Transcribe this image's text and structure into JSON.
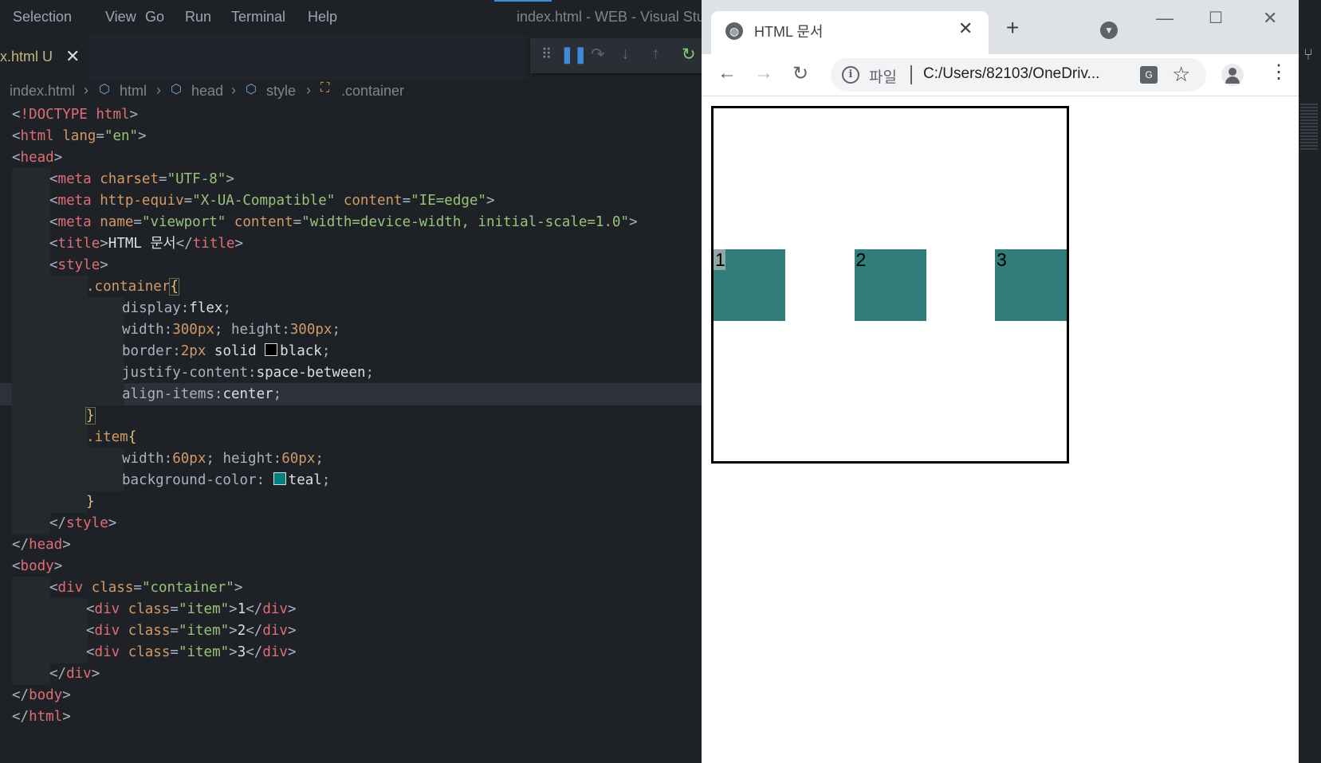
{
  "vscode": {
    "menu": [
      "Selection",
      "View",
      "Go",
      "Run",
      "Terminal",
      "Help"
    ],
    "window_title": "index.html - WEB - Visual Stu",
    "tab": {
      "name": "x.html U",
      "close": "✕"
    },
    "debug_icons": [
      "drag-handle-icon",
      "pause-icon",
      "step-over-icon",
      "step-into-icon",
      "step-out-icon",
      "restart-icon"
    ],
    "breadcrumb": [
      "index.html",
      "html",
      "head",
      "style",
      ".container"
    ],
    "code": {
      "doctype": "<!DOCTYPE html>",
      "l_html_open": "lang",
      "l_html_lang": "\"en\"",
      "meta1_attr": "charset",
      "meta1_val": "\"UTF-8\"",
      "meta2_attr1": "http-equiv",
      "meta2_val1": "\"X-UA-Compatible\"",
      "meta2_attr2": "content",
      "meta2_val2": "\"IE=edge\"",
      "meta3_attr1": "name",
      "meta3_val1": "\"viewport\"",
      "meta3_attr2": "content",
      "meta3_val2": "\"width=device-width, initial-scale=1.0\"",
      "title_text": "HTML 문서",
      "container_selector": ".container",
      "display": "display:",
      "display_val": "flex",
      "width": "width:",
      "width_val": "300px",
      "height": "height:",
      "height_val": "300px",
      "border": "border:",
      "border_num": "2px",
      "border_rest": "solid",
      "border_color": "black",
      "justify": "justify-content:",
      "justify_val": "space-between",
      "align": "align-items:",
      "align_val": "center",
      "item_selector": ".item",
      "item_width": "width:",
      "item_width_val": "60px",
      "item_height": "height:",
      "item_height_val": "60px",
      "bg": "background-color: ",
      "bg_val": "teal",
      "div_class": "class",
      "div_container": "\"container\"",
      "item_class": "\"item\"",
      "item1": "1",
      "item2": "2",
      "item3": "3"
    },
    "colors": {
      "black_swatch": "#000000",
      "teal_swatch": "#008080"
    }
  },
  "chrome": {
    "tab_title": "HTML 문서",
    "tab_close": "✕",
    "new_tab": "+",
    "scheme_label": "파일",
    "url": "C:/Users/82103/OneDriv...",
    "window_controls": [
      "minimize-icon",
      "maximize-icon",
      "close-icon"
    ],
    "page": {
      "items": [
        "1",
        "2",
        "3"
      ],
      "item_color": "#317d79"
    }
  }
}
